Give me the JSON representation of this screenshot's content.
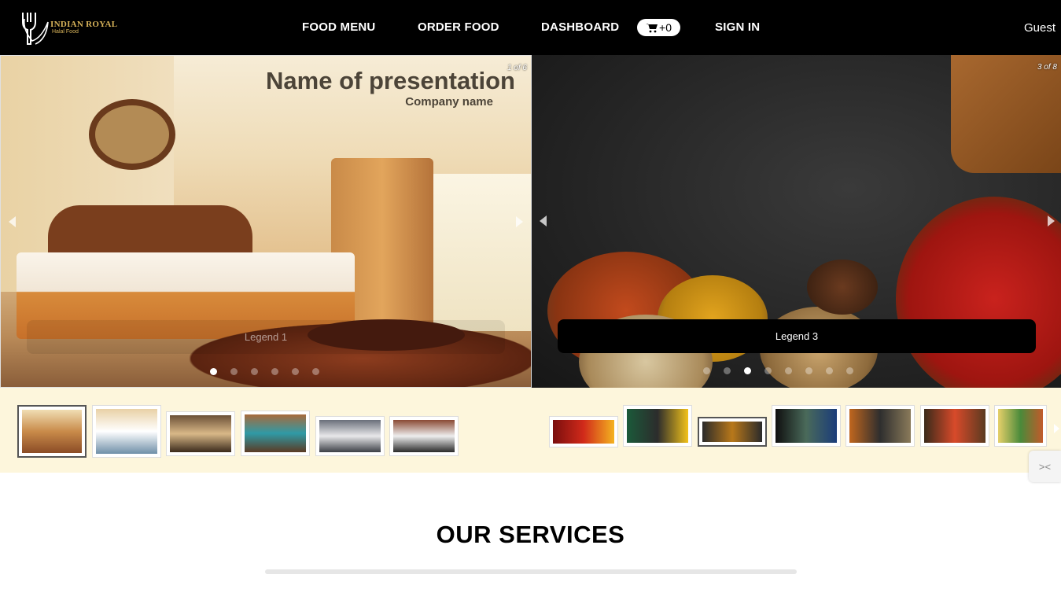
{
  "brand": {
    "name": "INDIAN ROYAL",
    "tagline": "Halal Food"
  },
  "nav": {
    "food_menu": "FOOD MENU",
    "order_food": "ORDER FOOD",
    "dashboard": "DASHBOARD",
    "cart_count": "+0",
    "sign_in": "SIGN IN",
    "user": "Guest"
  },
  "carousel_left": {
    "counter": "1 of 6",
    "slide_title": "Name of presentation",
    "slide_company": "Company name",
    "legend": "Legend 1",
    "slide_count": 6,
    "active_index": 0
  },
  "carousel_right": {
    "counter": "3 of 8",
    "legend": "Legend 3",
    "slide_count": 8,
    "active_index": 2
  },
  "services": {
    "title": "OUR SERVICES"
  },
  "colors": {
    "nav_bg": "#000000",
    "accent_gold": "#d9b45a",
    "strip_bg": "#fdf6dc"
  }
}
